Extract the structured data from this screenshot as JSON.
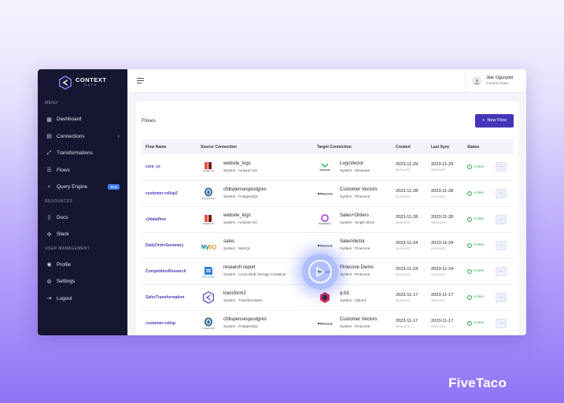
{
  "sidebar": {
    "brand_title": "CONTEXT",
    "brand_sub": "DATA",
    "sections": {
      "menu": "MENU",
      "resources": "RESOURCES",
      "user_management": "USER MANAGEMENT"
    },
    "items": {
      "dashboard": {
        "label": "Dashboard",
        "icon": "dashboard-icon"
      },
      "connections": {
        "label": "Connections",
        "icon": "grid-icon"
      },
      "transformations": {
        "label": "Transformations",
        "icon": "shuffle-icon"
      },
      "flows": {
        "label": "Flows",
        "icon": "list-icon"
      },
      "query_engine": {
        "label": "Query Engine",
        "icon": "search-icon",
        "badge": "Beta"
      },
      "docs": {
        "label": "Docs",
        "icon": "document-icon"
      },
      "slack": {
        "label": "Slack",
        "icon": "slack-icon"
      },
      "profile": {
        "label": "Profile",
        "icon": "user-icon"
      },
      "settings": {
        "label": "Settings",
        "icon": "gear-icon"
      },
      "logout": {
        "label": "Logout",
        "icon": "logout-icon"
      }
    }
  },
  "topbar": {
    "user_name": "Jide Ogunjobi",
    "user_org": "Context Data"
  },
  "flows": {
    "title": "Flows",
    "new_button": "New Flow",
    "columns": [
      "Flow Name",
      "Source Connection",
      "Target Connection",
      "Created",
      "Last Sync",
      "Status"
    ],
    "rows": [
      {
        "name": "core_cx",
        "src_name": "website_logs",
        "src_sys": "System : Amazon S3",
        "src_logo": "amazon-s3",
        "tgt_name": "LogsVector",
        "tgt_sys": "System : Weaviate",
        "tgt_logo": "weaviate",
        "created_date": "2023-11-29",
        "created_time": "00:23 UTC",
        "sync_date": "2023-11-29",
        "sync_time": "00:23 UTC",
        "status": "Active"
      },
      {
        "name": "customer-rollup2",
        "src_name": "cfdispensespostgres",
        "src_sys": "System : PostgreSQL",
        "src_logo": "postgresql",
        "tgt_name": "Customer Vectors",
        "tgt_sys": "System : Pinecone",
        "tgt_logo": "pinecone",
        "created_date": "2023-11-28",
        "created_time": "21:14 UTC",
        "sync_date": "2023-11-28",
        "sync_time": "21:14 UTC",
        "status": "Active"
      },
      {
        "name": "s3dataflow",
        "src_name": "website_logs",
        "src_sys": "System : Amazon S3",
        "src_logo": "amazon-s3",
        "tgt_name": "Sales+Orders",
        "tgt_sys": "System : Single Store",
        "tgt_logo": "singlestore",
        "created_date": "2023-11-28",
        "created_time": "16:53 UTC",
        "sync_date": "2023-11-28",
        "sync_time": "16:53 UTC",
        "status": "Active"
      },
      {
        "name": "DailyOrderSummary",
        "src_name": "sales",
        "src_sys": "System : MySQL",
        "src_logo": "mysql",
        "tgt_name": "SalesVector",
        "tgt_sys": "System : Pinecone",
        "tgt_logo": "pinecone",
        "created_date": "2023-11-24",
        "created_time": "21:23 UTC",
        "sync_date": "2023-11-24",
        "sync_time": "21:23 UTC",
        "status": "Active"
      },
      {
        "name": "CompetitionResearch",
        "src_name": "research report",
        "src_sys": "System : Azure Blob Storage Container",
        "src_logo": "azure-blob",
        "tgt_name": "Pinecone Demo",
        "tgt_sys": "System : Pinecone",
        "tgt_logo": "pinecone",
        "created_date": "2023-11-24",
        "created_time": "21:13 UTC",
        "sync_date": "2023-11-24",
        "sync_time": "21:13 UTC",
        "status": "Active"
      },
      {
        "name": "SalesTransformation",
        "src_name": "transform2",
        "src_sys": "System : Transformation",
        "src_logo": "transformation",
        "tgt_name": "q-b1",
        "tgt_sys": "System : Qdrant",
        "tgt_logo": "qdrant",
        "created_date": "2023-11-17",
        "created_time": "20:20 UTC",
        "sync_date": "2023-11-17",
        "sync_time": "20:20 UTC",
        "status": "Active"
      },
      {
        "name": "customer-rollup",
        "src_name": "cfdispensespostgres",
        "src_sys": "System : PostgreSQL",
        "src_logo": "postgresql",
        "tgt_name": "Customer Vectors",
        "tgt_sys": "System : Pinecone",
        "tgt_logo": "pinecone",
        "created_date": "2023-11-17",
        "created_time": "20:04 UTC",
        "sync_date": "2023-11-17",
        "sync_time": "20:04 UTC",
        "status": "Active"
      }
    ]
  },
  "footer_brand": "FiveTaco",
  "colors": {
    "sidebar_bg": "#161631",
    "accent": "#4535b8",
    "active": "#2fa84f",
    "badge": "#3f7ef0"
  }
}
